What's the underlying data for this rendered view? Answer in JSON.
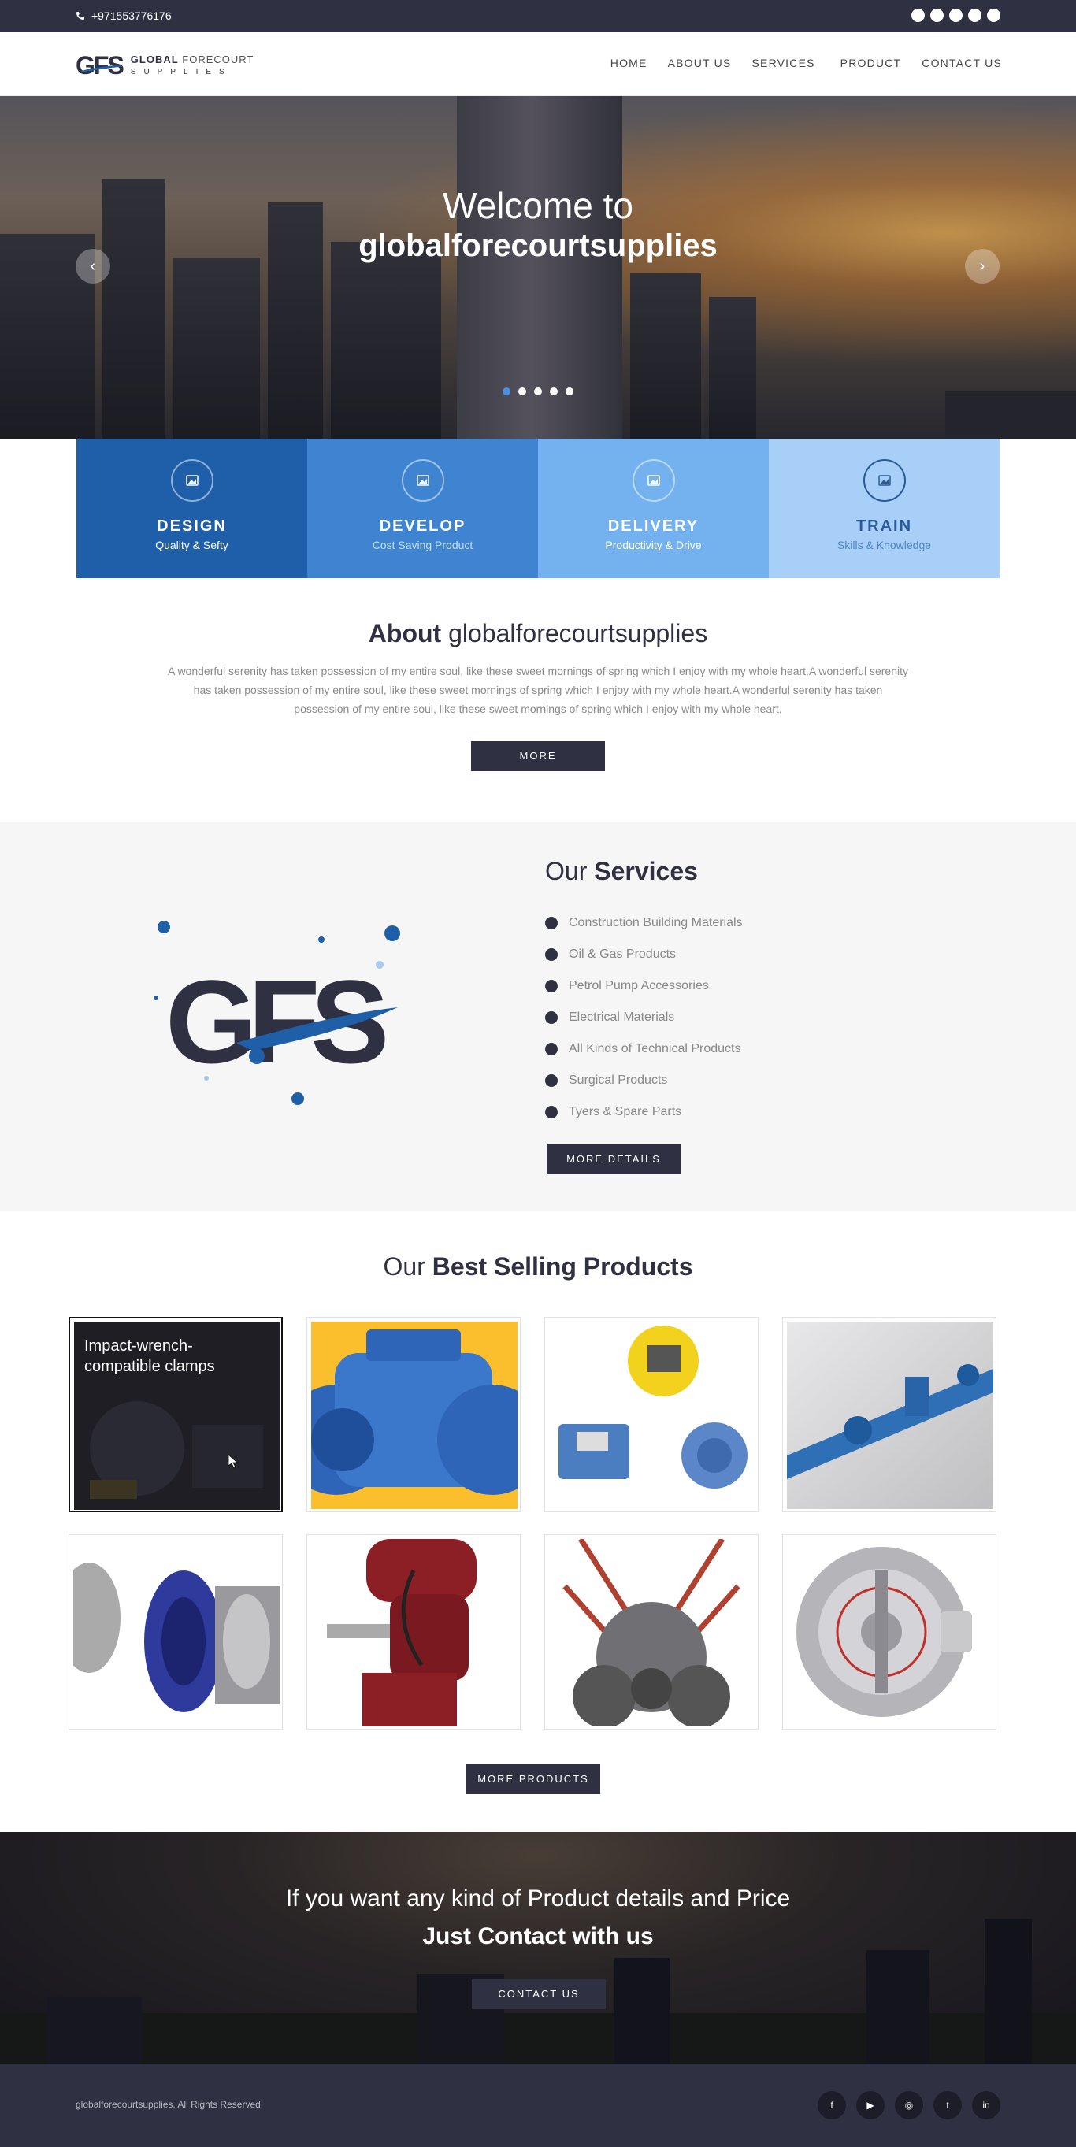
{
  "topbar": {
    "phone": "+971553776176",
    "social_icons": [
      "facebook-icon",
      "youtube-icon",
      "instagram-icon",
      "twitter-icon",
      "linkedin-icon"
    ]
  },
  "header": {
    "logo": {
      "mark": "GFS",
      "line1_bold": "GLOBAL",
      "line1_rest": " FORECOURT",
      "line2": "SUPPLIES"
    },
    "nav": [
      "HOME",
      "ABOUT US",
      "SERVICES",
      "PRODUCT",
      "CONTACT US"
    ]
  },
  "hero": {
    "line1": "Welcome to",
    "line2": "globalforecourtsupplies",
    "prev": "‹",
    "next": "›",
    "slides": 5,
    "active_slide": 0
  },
  "features": [
    {
      "title": "DESIGN",
      "sub": "Quality & Sefty"
    },
    {
      "title": "DEVELOP",
      "sub": "Cost Saving Product"
    },
    {
      "title": "DELIVERY",
      "sub": "Productivity & Drive"
    },
    {
      "title": "TRAIN",
      "sub": "Skills & Knowledge"
    }
  ],
  "about": {
    "title_bold": "About",
    "title_rest": " globalforecourtsupplies",
    "text": "A wonderful serenity has taken possession of my entire soul, like these sweet mornings of spring which I enjoy with my whole heart.A wonderful serenity has taken possession of my entire soul, like these sweet mornings of spring which I enjoy with my whole heart.A wonderful serenity has taken possession of my entire soul, like these sweet mornings of spring which I enjoy with my whole heart.",
    "button": "MORE"
  },
  "services": {
    "title_prefix": "Our ",
    "title_bold": "Services",
    "items": [
      "Construction Building Materials",
      "Oil & Gas Products",
      "Petrol Pump Accessories",
      "Electrical Materials",
      "All Kinds of Technical Products",
      "Surgical Products",
      "Tyers & Spare Parts"
    ],
    "button": "MORE DETAILS"
  },
  "products": {
    "title_prefix": "Our ",
    "title_bold": "Best Selling Products",
    "items": [
      {
        "caption": "Impact-wrench-compatible clamps",
        "image": "clamps-image"
      },
      {
        "caption": "",
        "image": "blue-valve-image"
      },
      {
        "caption": "",
        "image": "pressure-switch-image"
      },
      {
        "caption": "",
        "image": "pipe-assembly-image"
      },
      {
        "caption": "",
        "image": "pipe-coupling-image"
      },
      {
        "caption": "",
        "image": "red-hydrant-image"
      },
      {
        "caption": "",
        "image": "respirator-mask-image"
      },
      {
        "caption": "",
        "image": "flame-detector-image"
      }
    ],
    "button": "MORE PRODUCTS"
  },
  "cta": {
    "line1": "If you want any kind of Product details and Price",
    "line2": "Just Contact with us",
    "button": "CONTACT US"
  },
  "footer": {
    "copyright": "globalforecourtsupplies, All Rights Reserved",
    "social": [
      {
        "icon": "facebook-icon",
        "glyph": "f"
      },
      {
        "icon": "youtube-icon",
        "glyph": "▶"
      },
      {
        "icon": "instagram-icon",
        "glyph": "◎"
      },
      {
        "icon": "twitter-icon",
        "glyph": "t"
      },
      {
        "icon": "linkedin-icon",
        "glyph": "in"
      }
    ]
  }
}
